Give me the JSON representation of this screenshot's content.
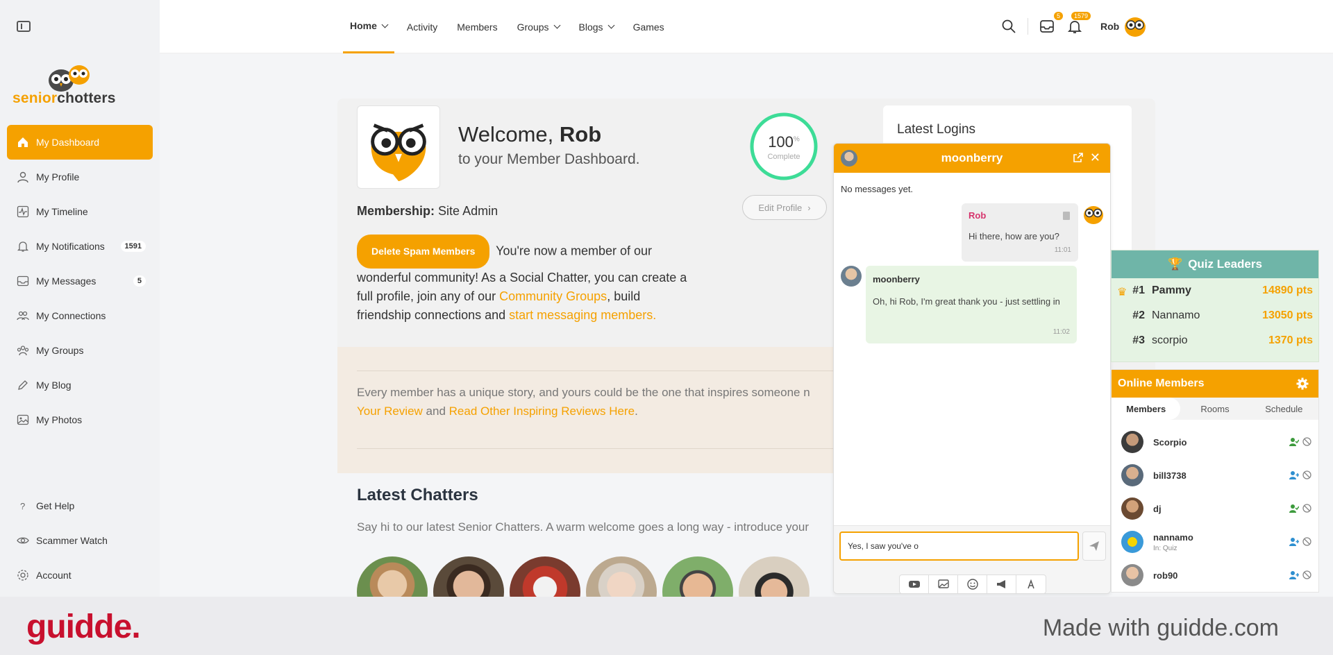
{
  "brand": {
    "part1": "senior",
    "part2": "chotters"
  },
  "sidebar": {
    "items": [
      {
        "label": "My Dashboard",
        "icon": "home-icon"
      },
      {
        "label": "My Profile",
        "icon": "user-icon"
      },
      {
        "label": "My Timeline",
        "icon": "activity-icon"
      },
      {
        "label": "My Notifications",
        "icon": "bell-icon",
        "badge": "1591"
      },
      {
        "label": "My Messages",
        "icon": "inbox-icon",
        "badge": "5"
      },
      {
        "label": "My Connections",
        "icon": "users-icon"
      },
      {
        "label": "My Groups",
        "icon": "group-icon"
      },
      {
        "label": "My Blog",
        "icon": "pencil-icon"
      },
      {
        "label": "My Photos",
        "icon": "image-icon"
      }
    ],
    "bottom": [
      {
        "label": "Get Help",
        "icon": "question-icon"
      },
      {
        "label": "Scammer Watch",
        "icon": "eye-icon"
      },
      {
        "label": "Account",
        "icon": "gear-icon"
      }
    ]
  },
  "topnav": {
    "items": [
      {
        "label": "Home"
      },
      {
        "label": "Activity"
      },
      {
        "label": "Members"
      },
      {
        "label": "Groups"
      },
      {
        "label": "Blogs"
      },
      {
        "label": "Games"
      }
    ]
  },
  "header": {
    "messages_badge": "5",
    "notifications_badge": "1579",
    "user_name": "Rob"
  },
  "welcome": {
    "greeting": "Welcome,",
    "name": "Rob",
    "subtitle": "to your Member Dashboard.",
    "progress_value": "100",
    "progress_unit": "%",
    "progress_label": "Complete",
    "edit_profile": "Edit Profile",
    "membership_label": "Membership:",
    "membership_value": "Site Admin",
    "delete_spam": "Delete Spam Members",
    "intro_1": "You're now a member of our wonderful community! As a Social Chatter, you can create a full profile, join any of our",
    "intro_link1": "Community Groups",
    "intro_2": ", build friendship connections and",
    "intro_link2": "start messaging members."
  },
  "review": {
    "text": "Every member has a unique story, and yours could be the one that inspires someone n",
    "link1": "Your Review",
    "and": "and",
    "link2": "Read Other Inspiring Reviews Here",
    "dot": "."
  },
  "latest_logins": {
    "title": "Latest Logins"
  },
  "chatters": {
    "title": "Latest Chatters",
    "subtitle": "Say hi to our latest Senior Chatters. A warm welcome goes a long way - introduce your"
  },
  "chat": {
    "title": "moonberry",
    "empty": "No messages yet.",
    "messages": [
      {
        "sender": "Rob",
        "text": "Hi there, how are you?",
        "time": "11:01"
      },
      {
        "sender": "moonberry",
        "text": "Oh, hi Rob, I'm great thank you - just settling in",
        "time": "11:02"
      }
    ],
    "input_value": "Yes, I saw you've o"
  },
  "quiz": {
    "title": "Quiz Leaders",
    "leaders": [
      {
        "rank": "#1",
        "name": "Pammy",
        "points": "14890 pts"
      },
      {
        "rank": "#2",
        "name": "Nannamo",
        "points": "13050 pts"
      },
      {
        "rank": "#3",
        "name": "scorpio",
        "points": "1370 pts"
      }
    ]
  },
  "online": {
    "title": "Online Members",
    "tabs": [
      "Members",
      "Rooms",
      "Schedule"
    ],
    "members": [
      {
        "name": "Scorpio",
        "sub": ""
      },
      {
        "name": "bill3738",
        "sub": ""
      },
      {
        "name": "dj",
        "sub": ""
      },
      {
        "name": "nannamo",
        "sub": "In: Quiz"
      },
      {
        "name": "rob90",
        "sub": ""
      }
    ]
  },
  "footer": {
    "logo": "guidde.",
    "made_with": "Made with guidde.com"
  },
  "colors": {
    "accent": "#f5a100",
    "quiz_header": "#6fb5a8",
    "guidde_red": "#c8102e"
  }
}
